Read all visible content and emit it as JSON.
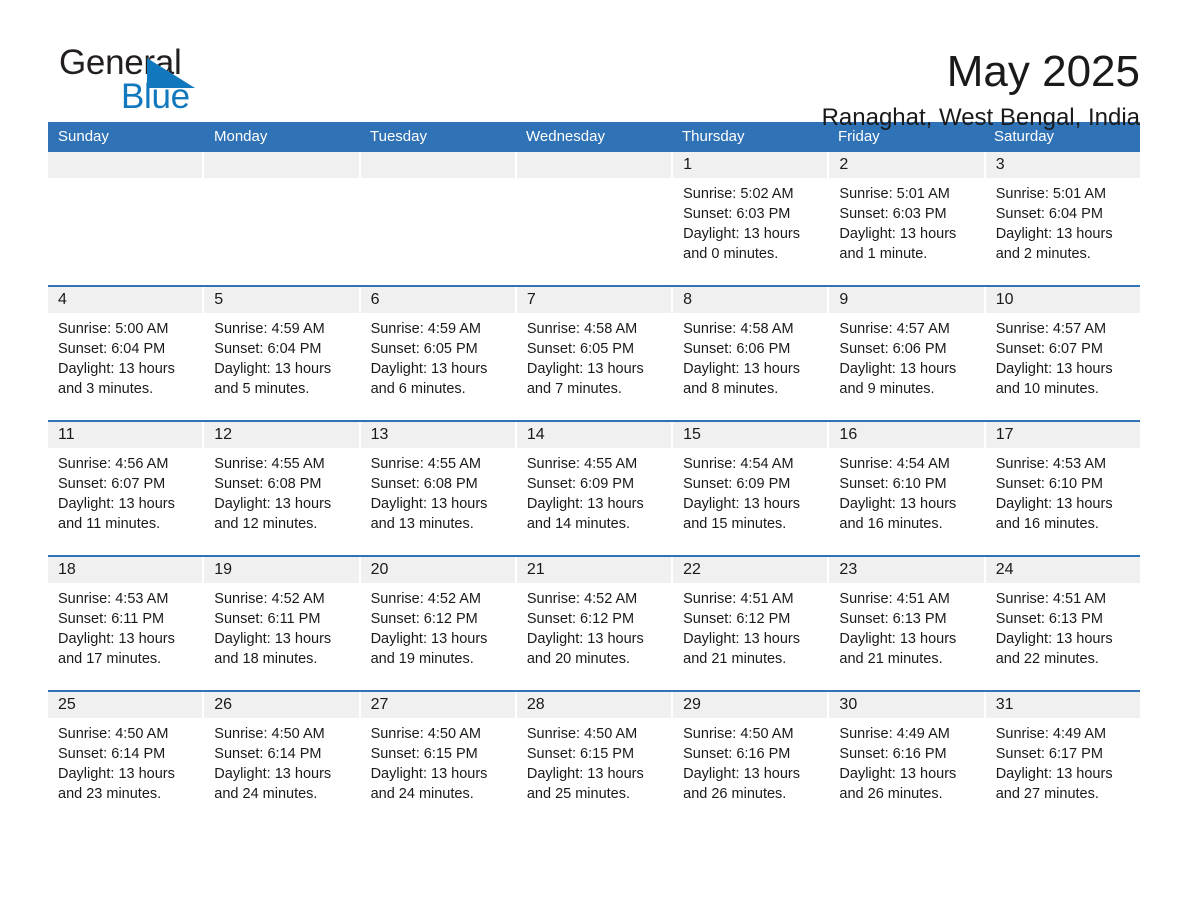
{
  "brand": {
    "name_part1": "General",
    "name_part2": "Blue"
  },
  "header": {
    "title": "May 2025",
    "location": "Ranaghat, West Bengal, India"
  },
  "colors": {
    "header_blue": "#2f72b5",
    "logo_blue": "#1278be",
    "daynum_band": "#f0f0f0",
    "text": "#1a1a1a"
  },
  "weekdays": [
    "Sunday",
    "Monday",
    "Tuesday",
    "Wednesday",
    "Thursday",
    "Friday",
    "Saturday"
  ],
  "weeks": [
    [
      {
        "day": "",
        "sunrise": "",
        "sunset": "",
        "daylight1": "",
        "daylight2": ""
      },
      {
        "day": "",
        "sunrise": "",
        "sunset": "",
        "daylight1": "",
        "daylight2": ""
      },
      {
        "day": "",
        "sunrise": "",
        "sunset": "",
        "daylight1": "",
        "daylight2": ""
      },
      {
        "day": "",
        "sunrise": "",
        "sunset": "",
        "daylight1": "",
        "daylight2": ""
      },
      {
        "day": "1",
        "sunrise": "Sunrise: 5:02 AM",
        "sunset": "Sunset: 6:03 PM",
        "daylight1": "Daylight: 13 hours",
        "daylight2": "and 0 minutes."
      },
      {
        "day": "2",
        "sunrise": "Sunrise: 5:01 AM",
        "sunset": "Sunset: 6:03 PM",
        "daylight1": "Daylight: 13 hours",
        "daylight2": "and 1 minute."
      },
      {
        "day": "3",
        "sunrise": "Sunrise: 5:01 AM",
        "sunset": "Sunset: 6:04 PM",
        "daylight1": "Daylight: 13 hours",
        "daylight2": "and 2 minutes."
      }
    ],
    [
      {
        "day": "4",
        "sunrise": "Sunrise: 5:00 AM",
        "sunset": "Sunset: 6:04 PM",
        "daylight1": "Daylight: 13 hours",
        "daylight2": "and 3 minutes."
      },
      {
        "day": "5",
        "sunrise": "Sunrise: 4:59 AM",
        "sunset": "Sunset: 6:04 PM",
        "daylight1": "Daylight: 13 hours",
        "daylight2": "and 5 minutes."
      },
      {
        "day": "6",
        "sunrise": "Sunrise: 4:59 AM",
        "sunset": "Sunset: 6:05 PM",
        "daylight1": "Daylight: 13 hours",
        "daylight2": "and 6 minutes."
      },
      {
        "day": "7",
        "sunrise": "Sunrise: 4:58 AM",
        "sunset": "Sunset: 6:05 PM",
        "daylight1": "Daylight: 13 hours",
        "daylight2": "and 7 minutes."
      },
      {
        "day": "8",
        "sunrise": "Sunrise: 4:58 AM",
        "sunset": "Sunset: 6:06 PM",
        "daylight1": "Daylight: 13 hours",
        "daylight2": "and 8 minutes."
      },
      {
        "day": "9",
        "sunrise": "Sunrise: 4:57 AM",
        "sunset": "Sunset: 6:06 PM",
        "daylight1": "Daylight: 13 hours",
        "daylight2": "and 9 minutes."
      },
      {
        "day": "10",
        "sunrise": "Sunrise: 4:57 AM",
        "sunset": "Sunset: 6:07 PM",
        "daylight1": "Daylight: 13 hours",
        "daylight2": "and 10 minutes."
      }
    ],
    [
      {
        "day": "11",
        "sunrise": "Sunrise: 4:56 AM",
        "sunset": "Sunset: 6:07 PM",
        "daylight1": "Daylight: 13 hours",
        "daylight2": "and 11 minutes."
      },
      {
        "day": "12",
        "sunrise": "Sunrise: 4:55 AM",
        "sunset": "Sunset: 6:08 PM",
        "daylight1": "Daylight: 13 hours",
        "daylight2": "and 12 minutes."
      },
      {
        "day": "13",
        "sunrise": "Sunrise: 4:55 AM",
        "sunset": "Sunset: 6:08 PM",
        "daylight1": "Daylight: 13 hours",
        "daylight2": "and 13 minutes."
      },
      {
        "day": "14",
        "sunrise": "Sunrise: 4:55 AM",
        "sunset": "Sunset: 6:09 PM",
        "daylight1": "Daylight: 13 hours",
        "daylight2": "and 14 minutes."
      },
      {
        "day": "15",
        "sunrise": "Sunrise: 4:54 AM",
        "sunset": "Sunset: 6:09 PM",
        "daylight1": "Daylight: 13 hours",
        "daylight2": "and 15 minutes."
      },
      {
        "day": "16",
        "sunrise": "Sunrise: 4:54 AM",
        "sunset": "Sunset: 6:10 PM",
        "daylight1": "Daylight: 13 hours",
        "daylight2": "and 16 minutes."
      },
      {
        "day": "17",
        "sunrise": "Sunrise: 4:53 AM",
        "sunset": "Sunset: 6:10 PM",
        "daylight1": "Daylight: 13 hours",
        "daylight2": "and 16 minutes."
      }
    ],
    [
      {
        "day": "18",
        "sunrise": "Sunrise: 4:53 AM",
        "sunset": "Sunset: 6:11 PM",
        "daylight1": "Daylight: 13 hours",
        "daylight2": "and 17 minutes."
      },
      {
        "day": "19",
        "sunrise": "Sunrise: 4:52 AM",
        "sunset": "Sunset: 6:11 PM",
        "daylight1": "Daylight: 13 hours",
        "daylight2": "and 18 minutes."
      },
      {
        "day": "20",
        "sunrise": "Sunrise: 4:52 AM",
        "sunset": "Sunset: 6:12 PM",
        "daylight1": "Daylight: 13 hours",
        "daylight2": "and 19 minutes."
      },
      {
        "day": "21",
        "sunrise": "Sunrise: 4:52 AM",
        "sunset": "Sunset: 6:12 PM",
        "daylight1": "Daylight: 13 hours",
        "daylight2": "and 20 minutes."
      },
      {
        "day": "22",
        "sunrise": "Sunrise: 4:51 AM",
        "sunset": "Sunset: 6:12 PM",
        "daylight1": "Daylight: 13 hours",
        "daylight2": "and 21 minutes."
      },
      {
        "day": "23",
        "sunrise": "Sunrise: 4:51 AM",
        "sunset": "Sunset: 6:13 PM",
        "daylight1": "Daylight: 13 hours",
        "daylight2": "and 21 minutes."
      },
      {
        "day": "24",
        "sunrise": "Sunrise: 4:51 AM",
        "sunset": "Sunset: 6:13 PM",
        "daylight1": "Daylight: 13 hours",
        "daylight2": "and 22 minutes."
      }
    ],
    [
      {
        "day": "25",
        "sunrise": "Sunrise: 4:50 AM",
        "sunset": "Sunset: 6:14 PM",
        "daylight1": "Daylight: 13 hours",
        "daylight2": "and 23 minutes."
      },
      {
        "day": "26",
        "sunrise": "Sunrise: 4:50 AM",
        "sunset": "Sunset: 6:14 PM",
        "daylight1": "Daylight: 13 hours",
        "daylight2": "and 24 minutes."
      },
      {
        "day": "27",
        "sunrise": "Sunrise: 4:50 AM",
        "sunset": "Sunset: 6:15 PM",
        "daylight1": "Daylight: 13 hours",
        "daylight2": "and 24 minutes."
      },
      {
        "day": "28",
        "sunrise": "Sunrise: 4:50 AM",
        "sunset": "Sunset: 6:15 PM",
        "daylight1": "Daylight: 13 hours",
        "daylight2": "and 25 minutes."
      },
      {
        "day": "29",
        "sunrise": "Sunrise: 4:50 AM",
        "sunset": "Sunset: 6:16 PM",
        "daylight1": "Daylight: 13 hours",
        "daylight2": "and 26 minutes."
      },
      {
        "day": "30",
        "sunrise": "Sunrise: 4:49 AM",
        "sunset": "Sunset: 6:16 PM",
        "daylight1": "Daylight: 13 hours",
        "daylight2": "and 26 minutes."
      },
      {
        "day": "31",
        "sunrise": "Sunrise: 4:49 AM",
        "sunset": "Sunset: 6:17 PM",
        "daylight1": "Daylight: 13 hours",
        "daylight2": "and 27 minutes."
      }
    ]
  ]
}
